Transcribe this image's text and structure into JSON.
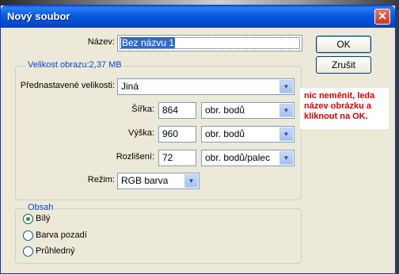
{
  "window": {
    "title": "Nový soubor",
    "close_glyph": "✕"
  },
  "name_field": {
    "label": "Název:",
    "value": "Bez názvu 1"
  },
  "buttons": {
    "ok": "OK",
    "cancel": "Zrušit"
  },
  "image_size": {
    "legend": "Velikost obrazu:2,37 MB",
    "preset": {
      "label": "Přednastavené velikosti:",
      "value": "Jiná"
    },
    "width": {
      "label": "Šířka:",
      "value": "864",
      "unit": "obr. bodů"
    },
    "height": {
      "label": "Výška:",
      "value": "960",
      "unit": "obr. bodů"
    },
    "resolution": {
      "label": "Rozlišení:",
      "value": "72",
      "unit": "obr. bodů/palec"
    },
    "mode": {
      "label": "Režim:",
      "value": "RGB barva"
    }
  },
  "contents": {
    "legend": "Obsah",
    "options": [
      {
        "label": "Bílý",
        "selected": true
      },
      {
        "label": "Barva pozadí",
        "selected": false
      },
      {
        "label": "Průhledný",
        "selected": false
      }
    ]
  },
  "note": "nic neměnit, leda název obrázku a kliknout na OK.",
  "icons": {
    "dropdown": "chevron-down-icon"
  },
  "colors": {
    "title_bar": "#0458e0",
    "note_text": "#e00000",
    "legend_text": "#0046d5"
  }
}
